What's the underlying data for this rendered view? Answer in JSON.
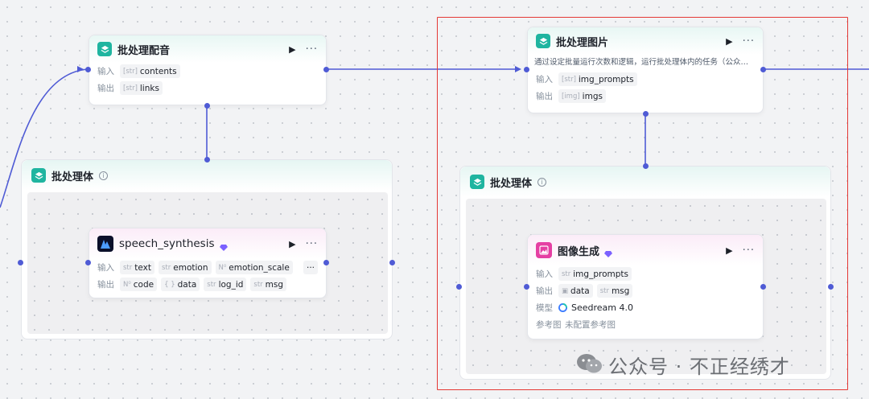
{
  "colors": {
    "wire": "#4f5bd5",
    "accent_teal": "#1fb5a0",
    "highlight": "#e53935"
  },
  "batch_dub": {
    "title": "批处理配音",
    "run_icon": "play-icon",
    "more_icon": "more-icon",
    "input_label": "输入",
    "input_type": "[str]",
    "input_name": "contents",
    "output_label": "输出",
    "output_type": "[str]",
    "output_name": "links"
  },
  "left_body": {
    "title": "批处理体",
    "speech": {
      "title": "speech_synthesis",
      "input_label": "输入",
      "inputs": [
        {
          "type": "str",
          "name": "text"
        },
        {
          "type": "str",
          "name": "emotion"
        },
        {
          "type": "N⁰",
          "name": "emotion_scale"
        }
      ],
      "overflow": "···",
      "output_label": "输出",
      "outputs": [
        {
          "type": "N⁰",
          "name": "code"
        },
        {
          "type": "{ }",
          "name": "data"
        },
        {
          "type": "str",
          "name": "log_id"
        },
        {
          "type": "str",
          "name": "msg"
        }
      ]
    }
  },
  "batch_image": {
    "title": "批处理图片",
    "desc": "通过设定批量运行次数和逻辑，运行批处理体内的任务（公众…",
    "input_label": "输入",
    "input_type": "[str]",
    "input_name": "img_prompts",
    "output_label": "输出",
    "output_type": "[img]",
    "output_name": "imgs"
  },
  "right_body": {
    "title": "批处理体",
    "imggen": {
      "title": "图像生成",
      "input_label": "输入",
      "input_type": "str",
      "input_name": "img_prompts",
      "output_label": "输出",
      "outputs": [
        {
          "type": "img",
          "name": "data"
        },
        {
          "type": "str",
          "name": "msg"
        }
      ],
      "model_label": "模型",
      "model_name": "Seedream 4.0",
      "ref_label": "参考图",
      "ref_value": "未配置参考图"
    }
  },
  "watermark": {
    "text": "公众号 · 不正经绣才"
  }
}
